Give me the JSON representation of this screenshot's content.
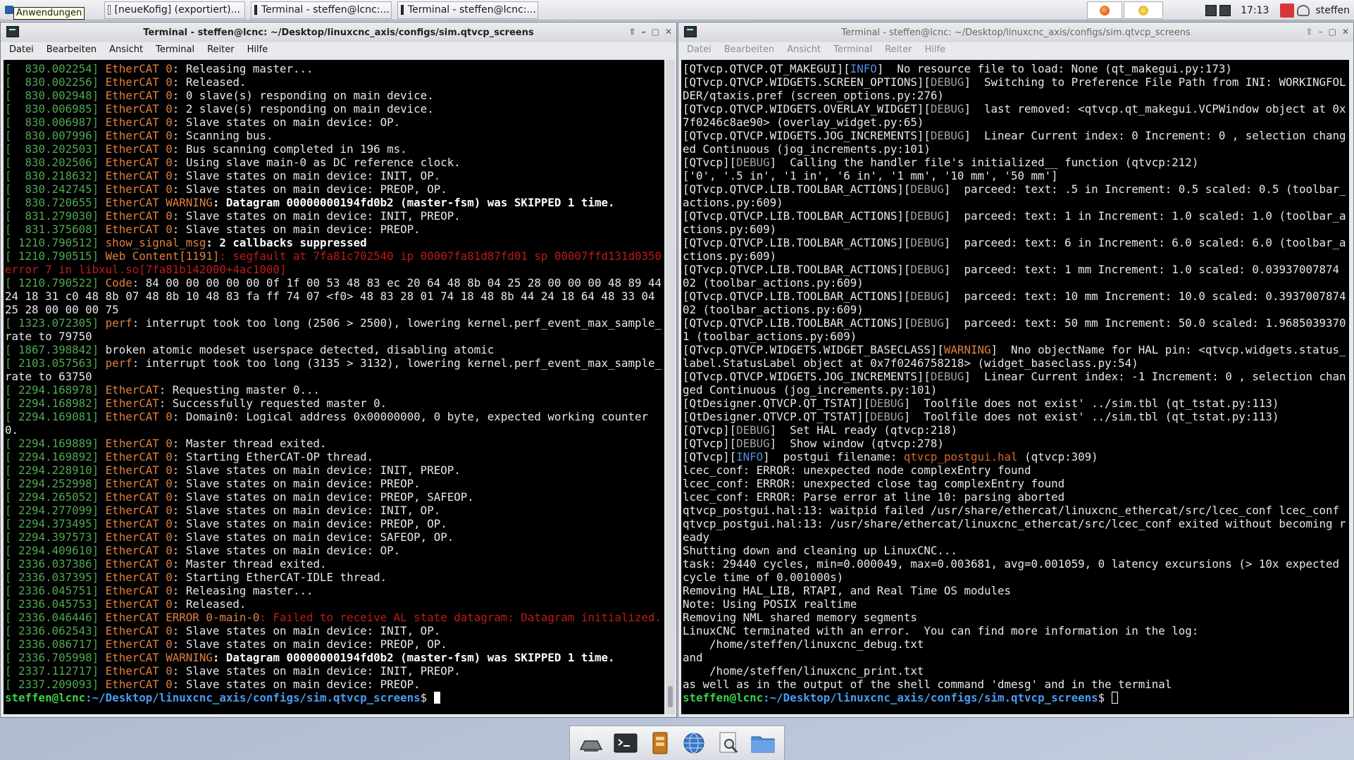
{
  "panel": {
    "apps_label": "Anwendungen",
    "tasks": [
      {
        "label": "[neueKofig] (exportiert)..."
      },
      {
        "label": "Terminal - steffen@lcnc:..."
      },
      {
        "label": "Terminal - steffen@lcnc:..."
      }
    ],
    "time": "17:13",
    "user": "steffen"
  },
  "left_window": {
    "title": "Terminal - steffen@lcnc: ~/Desktop/linuxcnc_axis/configs/sim.qtvcp_screens",
    "menu": [
      "Datei",
      "Bearbeiten",
      "Ansicht",
      "Terminal",
      "Reiter",
      "Hilfe"
    ],
    "lines": [
      [
        "[  830.002254] ",
        "EtherCAT ",
        "0",
        ": Releasing master..."
      ],
      [
        "[  830.002256] ",
        "EtherCAT ",
        "0",
        ": Released."
      ],
      [
        "[  830.002948] ",
        "EtherCAT ",
        "0",
        ": 0 slave(s) responding on main device."
      ],
      [
        "[  830.006985] ",
        "EtherCAT ",
        "0",
        ": 2 slave(s) responding on main device."
      ],
      [
        "[  830.006987] ",
        "EtherCAT ",
        "0",
        ": Slave states on main device: OP."
      ],
      [
        "[  830.007996] ",
        "EtherCAT ",
        "0",
        ": Scanning bus."
      ],
      [
        "[  830.202503] ",
        "EtherCAT ",
        "0",
        ": Bus scanning completed in 196 ms."
      ],
      [
        "[  830.202506] ",
        "EtherCAT ",
        "0",
        ": Using slave main-0 as DC reference clock."
      ],
      [
        "[  830.218632] ",
        "EtherCAT ",
        "0",
        ": Slave states on main device: INIT, OP."
      ],
      [
        "[  830.242745] ",
        "EtherCAT ",
        "0",
        ": Slave states on main device: PREOP, OP."
      ]
    ],
    "warn1": {
      "ts": "[  830.720655] ",
      "src": "EtherCAT WARNING",
      "msg": ": Datagram 00000000194fd0b2 (master-fsm) was SKIPPED 1 time."
    },
    "lines2": [
      [
        "[  831.279030] ",
        "EtherCAT ",
        "0",
        ": Slave states on main device: INIT, PREOP."
      ],
      [
        "[  831.375608] ",
        "EtherCAT ",
        "0",
        ": Slave states on main device: PREOP."
      ]
    ],
    "signal": {
      "ts": "[ 1210.790512] ",
      "src": "show_signal_msg",
      "msg": ": 2 callbacks suppressed"
    },
    "segfault": {
      "ts": "[ 1210.790515] ",
      "src": "Web Content[1191]",
      "msg": ": segfault at 7fa81c702540 ip 00007fa81d87fd01 sp 00007ffd131d0350 error 7 in libxul.so[7fa81b142000+4ac1000]"
    },
    "code": {
      "ts": "[ 1210.790522] ",
      "src": "Code",
      "msg": ": 84 00 00 00 00 00 0f 1f 00 53 48 83 ec 20 64 48 8b 04 25 28 00 00 00 48 89 44 24 18 31 c0 48 8b 07 48 8b 10 48 83 fa ff 74 07 <f0> 48 83 28 01 74 18 48 8b 44 24 18 64 48 33 04 25 28 00 00 00 75"
    },
    "perf1": {
      "ts": "[ 1323.072305] ",
      "src": "perf",
      "msg": ": interrupt took too long (2506 > 2500), lowering kernel.perf_event_max_sample_rate to 79750"
    },
    "atomic": {
      "ts": "[ 1867.398842] ",
      "msg": "broken atomic modeset userspace detected, disabling atomic"
    },
    "perf2": {
      "ts": "[ 2103.057563] ",
      "src": "perf",
      "msg": ": interrupt took too long (3135 > 3132), lowering kernel.perf_event_max_sample_rate to 63750"
    },
    "req": [
      [
        "[ 2294.168978] ",
        "EtherCAT",
        ": Requesting master 0..."
      ],
      [
        "[ 2294.168982] ",
        "EtherCAT",
        ": Successfully requested master 0."
      ]
    ],
    "lines3": [
      [
        "[ 2294.169081] ",
        "EtherCAT ",
        "0",
        ": Domain0: Logical address 0x00000000, 0 byte, expected working counter 0."
      ],
      [
        "[ 2294.169889] ",
        "EtherCAT ",
        "0",
        ": Master thread exited."
      ],
      [
        "[ 2294.169892] ",
        "EtherCAT ",
        "0",
        ": Starting EtherCAT-OP thread."
      ],
      [
        "[ 2294.228910] ",
        "EtherCAT ",
        "0",
        ": Slave states on main device: INIT, PREOP."
      ],
      [
        "[ 2294.252998] ",
        "EtherCAT ",
        "0",
        ": Slave states on main device: PREOP."
      ],
      [
        "[ 2294.265052] ",
        "EtherCAT ",
        "0",
        ": Slave states on main device: PREOP, SAFEOP."
      ],
      [
        "[ 2294.277099] ",
        "EtherCAT ",
        "0",
        ": Slave states on main device: INIT, OP."
      ],
      [
        "[ 2294.373495] ",
        "EtherCAT ",
        "0",
        ": Slave states on main device: PREOP, OP."
      ],
      [
        "[ 2294.397573] ",
        "EtherCAT ",
        "0",
        ": Slave states on main device: SAFEOP, OP."
      ],
      [
        "[ 2294.409610] ",
        "EtherCAT ",
        "0",
        ": Slave states on main device: OP."
      ],
      [
        "[ 2336.037386] ",
        "EtherCAT ",
        "0",
        ": Master thread exited."
      ],
      [
        "[ 2336.037395] ",
        "EtherCAT ",
        "0",
        ": Starting EtherCAT-IDLE thread."
      ],
      [
        "[ 2336.045751] ",
        "EtherCAT ",
        "0",
        ": Releasing master..."
      ],
      [
        "[ 2336.045753] ",
        "EtherCAT ",
        "0",
        ": Released."
      ]
    ],
    "error": {
      "ts": "[ 2336.046446] ",
      "src": "EtherCAT ERROR 0-main-0",
      "msg": ": Failed to receive AL state datagram: Datagram initialized."
    },
    "lines4": [
      [
        "[ 2336.062543] ",
        "EtherCAT ",
        "0",
        ": Slave states on main device: INIT, OP."
      ],
      [
        "[ 2336.086717] ",
        "EtherCAT ",
        "0",
        ": Slave states on main device: PREOP, OP."
      ]
    ],
    "warn2": {
      "ts": "[ 2336.705998] ",
      "src": "EtherCAT WARNING",
      "msg": ": Datagram 00000000194fd0b2 (master-fsm) was SKIPPED 1 time."
    },
    "lines5": [
      [
        "[ 2337.112717] ",
        "EtherCAT ",
        "0",
        ": Slave states on main device: INIT, PREOP."
      ],
      [
        "[ 2337.209093] ",
        "EtherCAT ",
        "0",
        ": Slave states on main device: PREOP."
      ]
    ],
    "prompt_user": "steffen@lcnc",
    "prompt_path": ":~/Desktop/linuxcnc_axis/configs/sim.qtvcp_screens",
    "prompt_end": "$ "
  },
  "right_window": {
    "title": "Terminal - steffen@lcnc: ~/Desktop/linuxcnc_axis/configs/sim.qtvcp_screens",
    "menu": [
      "Datei",
      "Bearbeiten",
      "Ansicht",
      "Terminal",
      "Reiter",
      "Hilfe"
    ],
    "lines": [
      {
        "tag": "[QTvcp.QTVCP.QT_MAKEGUI][",
        "lvl": "INFO",
        "cls": "info",
        "msg": "]  No resource file to load: None (qt_makegui.py:173)"
      },
      {
        "tag": "[QTvcp.QTVCP.WIDGETS.SCREEN_OPTIONS][",
        "lvl": "DEBUG",
        "cls": "tag",
        "msg": "]  Switching to Preference File Path from INI: WORKINGFOLDER/qtaxis.pref (screen_options.py:276)"
      },
      {
        "tag": "[QTvcp.QTVCP.WIDGETS.OVERLAY_WIDGET][",
        "lvl": "DEBUG",
        "cls": "tag",
        "msg": "]  last removed: <qtvcp.qt_makegui.VCPWindow object at 0x7f0246c8ae90> (overlay_widget.py:65)"
      },
      {
        "tag": "[QTvcp.QTVCP.WIDGETS.JOG_INCREMENTS][",
        "lvl": "DEBUG",
        "cls": "tag",
        "msg": "]  Linear Current index: 0 Increment: 0 , selection changed Continuous (jog_increments.py:101)"
      },
      {
        "tag": "[QTvcp][",
        "lvl": "DEBUG",
        "cls": "tag",
        "msg": "]  Calling the handler file's initialized__ function (qtvcp:212)"
      },
      {
        "tag": "",
        "lvl": "",
        "cls": "tag",
        "msg": "['0', '.5 in', '1 in', '6 in', '1 mm', '10 mm', '50 mm']"
      },
      {
        "tag": "[QTvcp.QTVCP.LIB.TOOLBAR_ACTIONS][",
        "lvl": "DEBUG",
        "cls": "tag",
        "msg": "]  parceed: text: .5 in Increment: 0.5 scaled: 0.5 (toolbar_actions.py:609)"
      },
      {
        "tag": "[QTvcp.QTVCP.LIB.TOOLBAR_ACTIONS][",
        "lvl": "DEBUG",
        "cls": "tag",
        "msg": "]  parceed: text: 1 in Increment: 1.0 scaled: 1.0 (toolbar_actions.py:609)"
      },
      {
        "tag": "[QTvcp.QTVCP.LIB.TOOLBAR_ACTIONS][",
        "lvl": "DEBUG",
        "cls": "tag",
        "msg": "]  parceed: text: 6 in Increment: 6.0 scaled: 6.0 (toolbar_actions.py:609)"
      },
      {
        "tag": "[QTvcp.QTVCP.LIB.TOOLBAR_ACTIONS][",
        "lvl": "DEBUG",
        "cls": "tag",
        "msg": "]  parceed: text: 1 mm Increment: 1.0 scaled: 0.03937007874 02 (toolbar_actions.py:609)"
      },
      {
        "tag": "[QTvcp.QTVCP.LIB.TOOLBAR_ACTIONS][",
        "lvl": "DEBUG",
        "cls": "tag",
        "msg": "]  parceed: text: 10 mm Increment: 10.0 scaled: 0.393700787402 (toolbar_actions.py:609)"
      },
      {
        "tag": "[QTvcp.QTVCP.LIB.TOOLBAR_ACTIONS][",
        "lvl": "DEBUG",
        "cls": "tag",
        "msg": "]  parceed: text: 50 mm Increment: 50.0 scaled: 1.96850393701 (toolbar_actions.py:609)"
      },
      {
        "tag": "[QTvcp.QTVCP.WIDGETS.WIDGET_BASECLASS][",
        "lvl": "WARNING",
        "cls": "warn",
        "msg": "]  Nno objectName for HAL pin: <qtvcp.widgets.status_label.StatusLabel object at 0x7f0246758218> (widget_baseclass.py:54)"
      },
      {
        "tag": "[QTvcp.QTVCP.WIDGETS.JOG_INCREMENTS][",
        "lvl": "DEBUG",
        "cls": "tag",
        "msg": "]  Linear Current index: -1 Increment: 0 , selection changed Continuous (jog_increments.py:101)"
      },
      {
        "tag": "[QtDesigner.QTVCP.QT_TSTAT][",
        "lvl": "DEBUG",
        "cls": "tag",
        "msg": "]  Toolfile does not exist' ../sim.tbl (qt_tstat.py:113)"
      },
      {
        "tag": "[QtDesigner.QTVCP.QT_TSTAT][",
        "lvl": "DEBUG",
        "cls": "tag",
        "msg": "]  Toolfile does not exist' ../sim.tbl (qt_tstat.py:113)"
      },
      {
        "tag": "[QTvcp][",
        "lvl": "DEBUG",
        "cls": "tag",
        "msg": "]  Set HAL ready (qtvcp:218)"
      },
      {
        "tag": "[QTvcp][",
        "lvl": "DEBUG",
        "cls": "tag",
        "msg": "]  Show window (qtvcp:278)"
      }
    ],
    "postgui": {
      "tag": "[QTvcp][",
      "lvl": "INFO",
      "mid": "]  postgui filename: ",
      "file": "qtvcp_postgui.hal",
      "end": " (qtvcp:309)"
    },
    "plain": [
      "lcec_conf: ERROR: unexpected node complexEntry found",
      "lcec_conf: ERROR: unexpected close tag complexEntry found",
      "lcec_conf: ERROR: Parse error at line 10: parsing aborted",
      "qtvcp_postgui.hal:13: waitpid failed /usr/share/ethercat/linuxcnc_ethercat/src/lcec_conf lcec_conf",
      "qtvcp_postgui.hal:13: /usr/share/ethercat/linuxcnc_ethercat/src/lcec_conf exited without becoming ready",
      "Shutting down and cleaning up LinuxCNC...",
      "task: 29440 cycles, min=0.000049, max=0.003681, avg=0.001059, 0 latency excursions (> 10x expected cycle time of 0.001000s)",
      "Removing HAL_LIB, RTAPI, and Real Time OS modules",
      "Note: Using POSIX realtime",
      "Removing NML shared memory segments",
      "LinuxCNC terminated with an error.  You can find more information in the log:",
      "    /home/steffen/linuxcnc_debug.txt",
      "and",
      "    /home/steffen/linuxcnc_print.txt",
      "as well as in the output of the shell command 'dmesg' and in the terminal"
    ],
    "prompt_user": "steffen@lcnc",
    "prompt_path": ":~/Desktop/linuxcnc_axis/configs/sim.qtvcp_screens",
    "prompt_end": "$ "
  },
  "dock": {
    "items": [
      "monitor-icon",
      "terminal-icon",
      "file-manager-icon",
      "web-browser-icon",
      "search-icon",
      "folder-icon"
    ]
  }
}
